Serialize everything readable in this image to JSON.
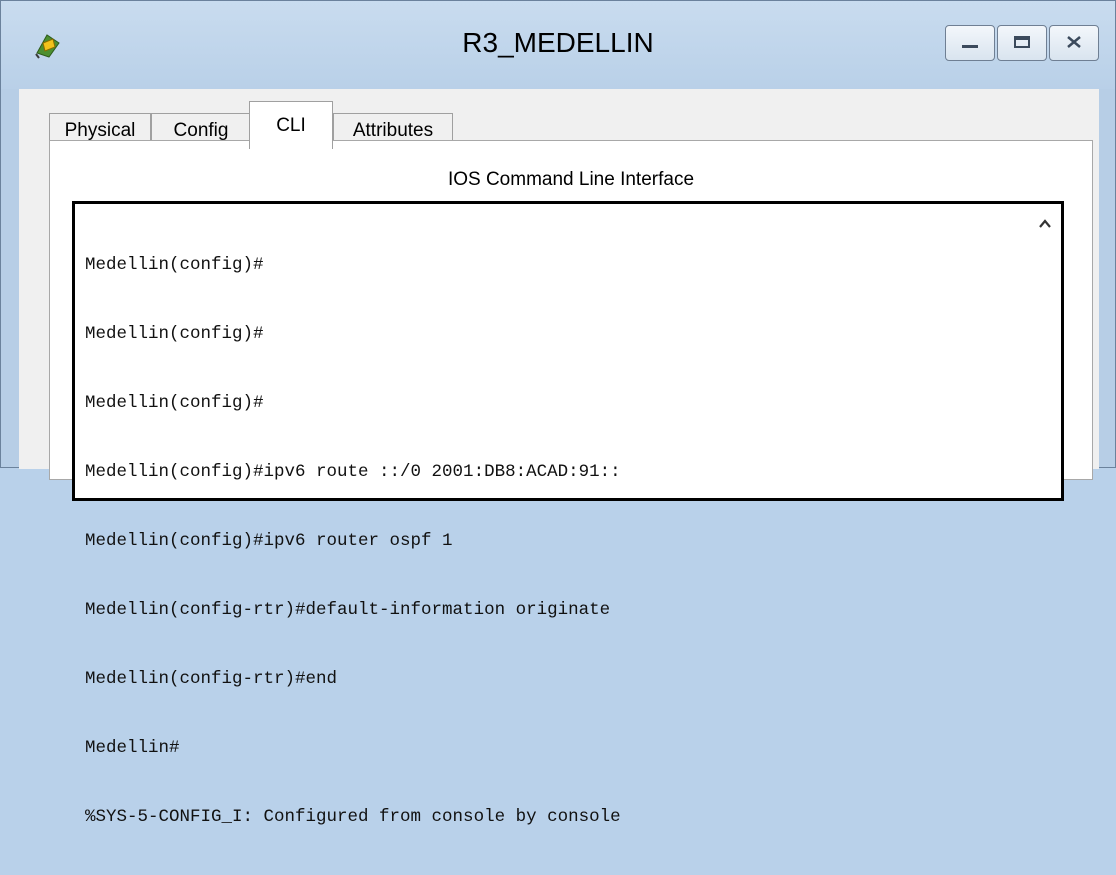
{
  "window": {
    "title": "R3_MEDELLIN",
    "icon": "router-icon"
  },
  "controls": {
    "minimize_icon": "minimize-icon",
    "maximize_icon": "maximize-icon",
    "close_icon": "close-icon"
  },
  "tabs": [
    {
      "label": "Physical",
      "active": false
    },
    {
      "label": "Config",
      "active": false
    },
    {
      "label": "CLI",
      "active": true
    },
    {
      "label": "Attributes",
      "active": false
    }
  ],
  "panel": {
    "title": "IOS Command Line Interface"
  },
  "terminal": {
    "lines": [
      "Medellin(config)#",
      "Medellin(config)#",
      "Medellin(config)#",
      "Medellin(config)#ipv6 route ::/0 2001:DB8:ACAD:91::",
      "Medellin(config)#ipv6 router ospf 1",
      "Medellin(config-rtr)#default-information originate",
      "Medellin(config-rtr)#end",
      "Medellin#",
      "%SYS-5-CONFIG_I: Configured from console by console"
    ]
  }
}
